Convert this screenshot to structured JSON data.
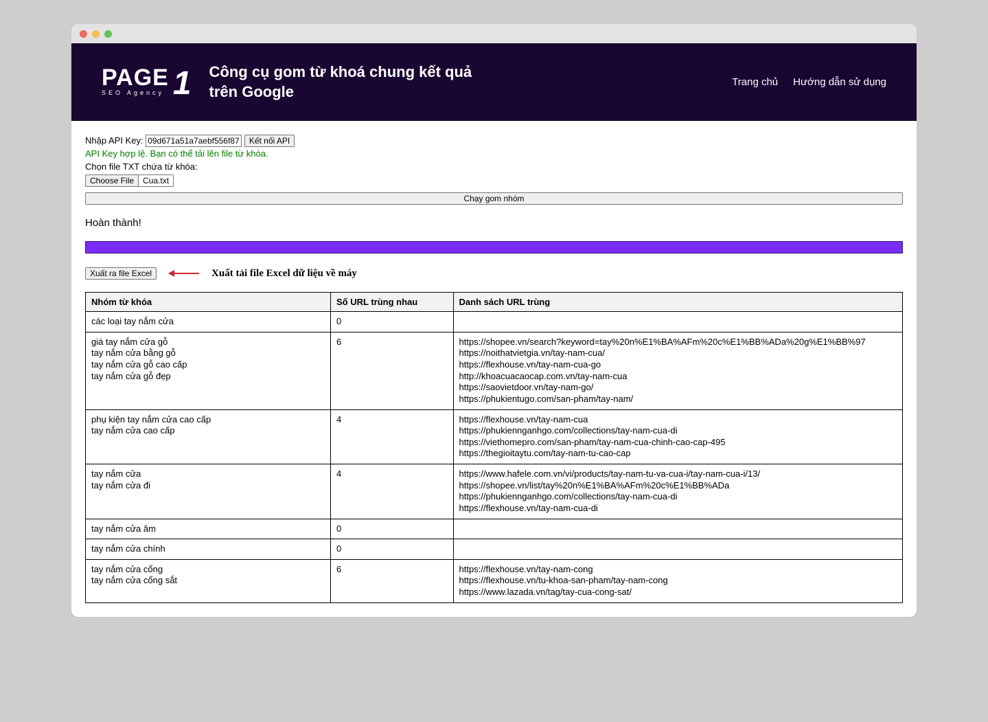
{
  "header": {
    "logo_main": "PAGE",
    "logo_sub": "SEO Agency",
    "logo_one": "1",
    "title": "Công cụ gom từ khoá chung kết quả trên Google"
  },
  "nav": {
    "home": "Trang chủ",
    "guide": "Hướng dẫn sử dụng"
  },
  "api": {
    "label": "Nhập API Key:",
    "value": "09d671a51a7aebf556f87",
    "connect_btn": "Kết nối API",
    "success_msg": "API Key hợp lệ. Bạn có thể tải lên file từ khóa."
  },
  "file": {
    "label": "Chọn file TXT chứa từ khóa:",
    "choose_btn": "Choose File",
    "filename": "Cua.txt"
  },
  "run_btn": "Chạy gom nhóm",
  "status": "Hoàn thành!",
  "export": {
    "btn": "Xuất ra file Excel",
    "hint": "Xuất tải file Excel dữ liệu về máy"
  },
  "table": {
    "headers": {
      "kw": "Nhóm từ khóa",
      "count": "Số URL trùng nhau",
      "urls": "Danh sách URL trùng"
    },
    "rows": [
      {
        "keywords": [
          "các loại tay nắm cửa"
        ],
        "count": 0,
        "urls": []
      },
      {
        "keywords": [
          "giá tay nắm cửa gỗ",
          "tay nắm cửa bằng gỗ",
          "tay nắm cửa gỗ cao cấp",
          "tay nắm cửa gỗ đẹp"
        ],
        "count": 6,
        "urls": [
          "https://shopee.vn/search?keyword=tay%20n%E1%BA%AFm%20c%E1%BB%ADa%20g%E1%BB%97",
          "https://noithatvietgia.vn/tay-nam-cua/",
          "https://flexhouse.vn/tay-nam-cua-go",
          "http://khoacuacaocap.com.vn/tay-nam-cua",
          "https://saovietdoor.vn/tay-nam-go/",
          "https://phukientugo.com/san-pham/tay-nam/"
        ]
      },
      {
        "keywords": [
          "phụ kiện tay nắm cửa cao cấp",
          "tay nắm cửa cao cấp"
        ],
        "count": 4,
        "urls": [
          "https://flexhouse.vn/tay-nam-cua",
          "https://phukiennganhgo.com/collections/tay-nam-cua-di",
          "https://viethomepro.com/san-pham/tay-nam-cua-chinh-cao-cap-495",
          "https://thegioitaytu.com/tay-nam-tu-cao-cap"
        ]
      },
      {
        "keywords": [
          "tay nắm cửa",
          "tay nắm cửa đi"
        ],
        "count": 4,
        "urls": [
          "https://www.hafele.com.vn/vi/products/tay-nam-tu-va-cua-i/tay-nam-cua-i/13/",
          "https://shopee.vn/list/tay%20n%E1%BA%AFm%20c%E1%BB%ADa",
          "https://phukiennganhgo.com/collections/tay-nam-cua-di",
          "https://flexhouse.vn/tay-nam-cua-di"
        ]
      },
      {
        "keywords": [
          "tay nắm cửa âm"
        ],
        "count": 0,
        "urls": []
      },
      {
        "keywords": [
          "tay nắm cửa chính"
        ],
        "count": 0,
        "urls": []
      },
      {
        "keywords": [
          "tay nắm cửa cổng",
          "tay nắm cửa cổng sắt"
        ],
        "count": 6,
        "urls": [
          "https://flexhouse.vn/tay-nam-cong",
          "https://flexhouse.vn/tu-khoa-san-pham/tay-nam-cong",
          "https://www.lazada.vn/tag/tay-cua-cong-sat/"
        ]
      }
    ]
  }
}
